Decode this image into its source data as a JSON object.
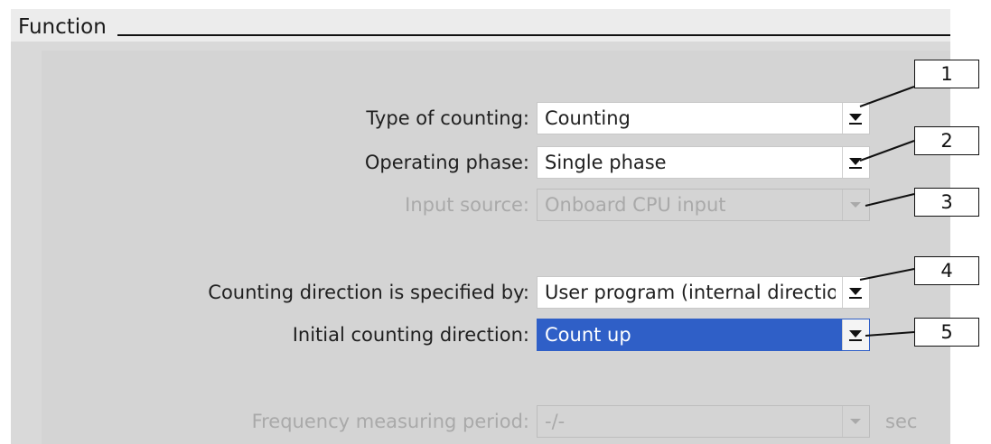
{
  "section": {
    "title": "Function"
  },
  "fields": [
    {
      "label": "Type of counting:",
      "value": "Counting",
      "state": "enabled"
    },
    {
      "label": "Operating phase:",
      "value": "Single phase",
      "state": "enabled"
    },
    {
      "label": "Input source:",
      "value": "Onboard CPU input",
      "state": "disabled"
    },
    {
      "label": "Counting direction is specified by:",
      "value": "User program (internal direction control)",
      "state": "enabled"
    },
    {
      "label": "Initial counting direction:",
      "value": "Count up",
      "state": "selected"
    },
    {
      "label": "Frequency measuring period:",
      "value": "-/-",
      "state": "disabled",
      "unit": "sec"
    }
  ],
  "callouts": [
    "1",
    "2",
    "3",
    "4",
    "5"
  ],
  "colors": {
    "panel_bg": "#d4d4d4",
    "selection": "#2f5fc7",
    "disabled_text": "#a9a9a9"
  },
  "icons": {
    "dropdown": "triangle-down-icon"
  }
}
